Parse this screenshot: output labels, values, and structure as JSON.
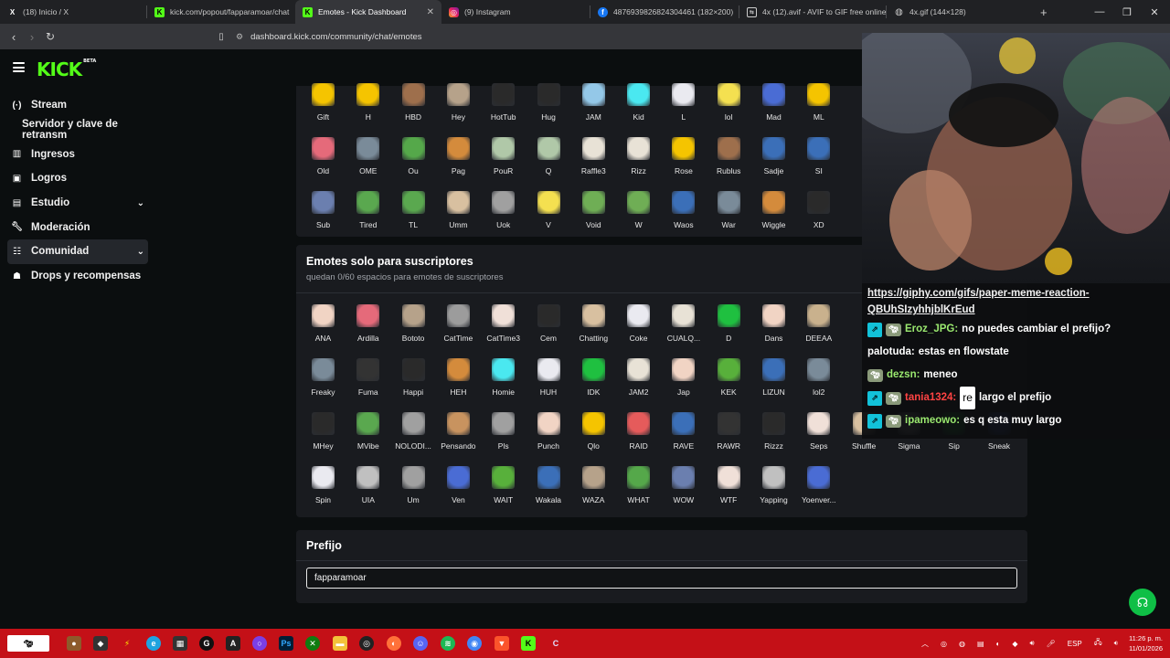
{
  "browser": {
    "tabs": [
      {
        "title": "(18) Inicio / X",
        "icon": "x-logo-icon",
        "active": false
      },
      {
        "title": "kick.com/popout/fapparamoar/chat",
        "icon": "kick-logo-icon",
        "active": false
      },
      {
        "title": "Emotes - Kick Dashboard",
        "icon": "kick-logo-icon",
        "active": true
      },
      {
        "title": "(9) Instagram",
        "icon": "instagram-icon",
        "active": false
      },
      {
        "title": "4876939826824304461 (182×200)",
        "icon": "facebook-icon",
        "active": false
      },
      {
        "title": "4x (12).avif - AVIF to GIF free online c...",
        "icon": "converter-icon",
        "active": false
      },
      {
        "title": "4x.gif (144×128)",
        "icon": "globe-icon",
        "active": false
      }
    ],
    "url": "dashboard.kick.com/community/chat/emotes"
  },
  "brand": {
    "logo": "KICK",
    "beta": "BETA",
    "accent": "#53fc18"
  },
  "sidebar": {
    "items": [
      {
        "label": "Stream",
        "icon": "broadcast-icon"
      },
      {
        "label": "Servidor y clave de retransm",
        "icon": ""
      },
      {
        "label": "Ingresos",
        "icon": "chart-icon"
      },
      {
        "label": "Logros",
        "icon": "trophy-icon"
      },
      {
        "label": "Estudio",
        "icon": "layout-icon"
      },
      {
        "label": "Moderación",
        "icon": "wrench-icon"
      },
      {
        "label": "Comunidad",
        "icon": "community-icon"
      },
      {
        "label": "Drops y recompensas",
        "icon": "gift-icon"
      }
    ]
  },
  "global_emotes": {
    "rows": [
      [
        "Gift",
        "H",
        "HBD",
        "Hey",
        "HotTub",
        "Hug",
        "JAM",
        "Kid",
        "L",
        "lol",
        "Mad",
        "ML"
      ],
      [
        "Old",
        "OME",
        "Ou",
        "Pag",
        "PouR",
        "Q",
        "Raffle3",
        "Rizz",
        "Rose",
        "Rublus",
        "Sadje",
        "SI"
      ],
      [
        "Sub",
        "Tired",
        "TL",
        "Umm",
        "Uok",
        "V",
        "Void",
        "W",
        "Waos",
        "War",
        "Wiggle",
        "XD"
      ]
    ]
  },
  "sub_emotes": {
    "title": "Emotes solo para suscriptores",
    "subtitle": "quedan 0/60 espacios para emotes de suscriptores",
    "rows": [
      [
        "ANA",
        "Ardilla",
        "Bototo",
        "CatTime",
        "CatTime3",
        "Cem",
        "Chatting",
        "Coke",
        "CUALQ...",
        "D",
        "Dans",
        "DEEAA"
      ],
      [
        "Freaky",
        "Fuma",
        "Happi",
        "HEH",
        "Homie",
        "HUH",
        "IDK",
        "JAM2",
        "Jap",
        "KEK",
        "LIZUN",
        "lol2"
      ],
      [
        "MHey",
        "MVibe",
        "NOLODI...",
        "Pensando",
        "Pls",
        "Punch",
        "Qlo",
        "RAID",
        "RAVE",
        "RAWR",
        "Rizzz",
        "Seps",
        "Shuffle",
        "Sigma",
        "Sip",
        "Sneak"
      ],
      [
        "Spin",
        "UIA",
        "Um",
        "Ven",
        "WAIT",
        "Wakala",
        "WAZA",
        "WHAT",
        "WOW",
        "WTF",
        "Yapping",
        "Yoenver..."
      ]
    ]
  },
  "prefix": {
    "title": "Prefijo",
    "value": "fapparamoar"
  },
  "overlay": {
    "chat": [
      {
        "type": "link",
        "text": "https://giphy.com/gifs/paper-meme-reaction-QBUhSIzyhhjblKrEud"
      },
      {
        "badges": [
          "kick",
          "sub"
        ],
        "user": "Eroz_JPG:",
        "message": "no puedes cambiar el prefijo?",
        "color": "#9ae86f"
      },
      {
        "badges": [],
        "user": "palotuda:",
        "message": "estas en flowstate",
        "color": "#ffffff"
      },
      {
        "badges": [
          "sub"
        ],
        "user": "dezsn:",
        "message": "meneo",
        "color": "#9ae86f"
      },
      {
        "badges": [
          "kick",
          "sub"
        ],
        "user": "tania1324:",
        "emote": "re",
        "message": "largo el prefijo",
        "color": "#ff4343"
      },
      {
        "badges": [
          "kick",
          "sub"
        ],
        "user": "ipameowo:",
        "message": "es q esta muy largo",
        "color": "#9ae86f"
      }
    ]
  },
  "taskbar": {
    "language": "ESP",
    "time": "11:26 p. m.",
    "date": "11/01/2026"
  }
}
